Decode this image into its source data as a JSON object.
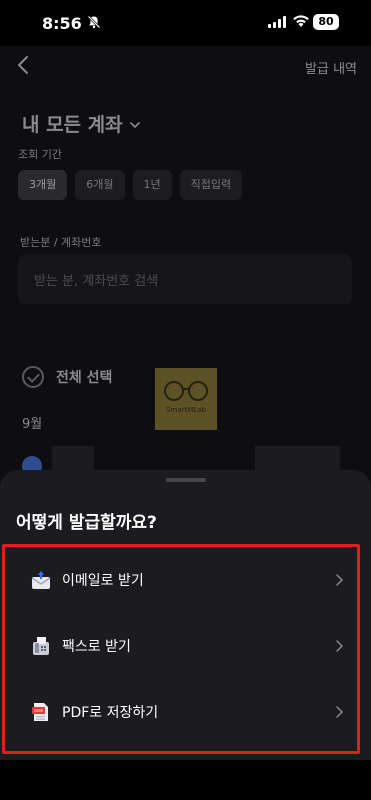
{
  "status_bar": {
    "time": "8:56",
    "battery": "80",
    "icons": [
      "bell-off-icon",
      "signal-icon",
      "wifi-icon",
      "battery-icon"
    ]
  },
  "page": {
    "history_link": "발급 내역",
    "title": "내 모든 계좌",
    "period_label": "조회 기간",
    "period_chips": [
      "3개월",
      "6개월",
      "1년",
      "직접입력"
    ],
    "selected_period": "3개월",
    "recipient_label": "받는분 / 계좌번호",
    "search_placeholder": "받는 분, 계좌번호 검색",
    "select_all_label": "전체 선택",
    "month_label": "9월",
    "watermark_text": "SmartMLab"
  },
  "sheet": {
    "title": "어떻게 발급할까요?",
    "options": [
      {
        "label": "이메일로 받기",
        "icon": "email-icon"
      },
      {
        "label": "팩스로 받기",
        "icon": "fax-icon"
      },
      {
        "label": "PDF로 저장하기",
        "icon": "pdf-icon"
      }
    ],
    "highlight_color": "#e41e1e"
  }
}
